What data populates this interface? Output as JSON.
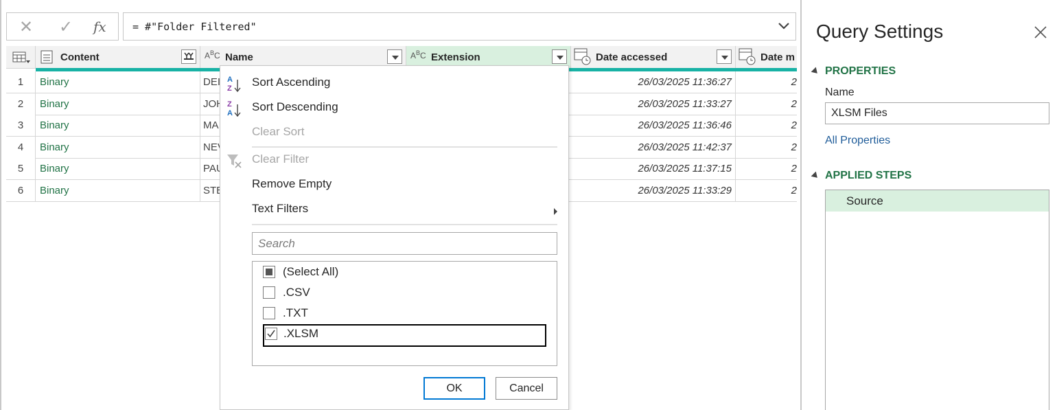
{
  "formula_bar": {
    "cancel_icon": "close-icon",
    "commit_icon": "check-icon",
    "fx_label": "fx",
    "formula": "= #\"Folder Filtered\""
  },
  "table": {
    "columns": [
      {
        "name": "Content",
        "type_icon": "table-type-icon"
      },
      {
        "name": "Name",
        "type_icon": "abc-type-icon"
      },
      {
        "name": "Extension",
        "type_icon": "abc-type-icon"
      },
      {
        "name": "Date accessed",
        "type_icon": "datetime-type-icon"
      },
      {
        "name": "Date m",
        "type_icon": "datetime-type-icon"
      }
    ],
    "rows": [
      {
        "num": "1",
        "content": "Binary",
        "name": "DEI",
        "date_accessed": "26/03/2025 11:36:27",
        "date_m": "2"
      },
      {
        "num": "2",
        "content": "Binary",
        "name": "JOH",
        "date_accessed": "26/03/2025 11:33:27",
        "date_m": "2"
      },
      {
        "num": "3",
        "content": "Binary",
        "name": "MA",
        "date_accessed": "26/03/2025 11:36:46",
        "date_m": "2"
      },
      {
        "num": "4",
        "content": "Binary",
        "name": "NEV",
        "date_accessed": "26/03/2025 11:42:37",
        "date_m": "2"
      },
      {
        "num": "5",
        "content": "Binary",
        "name": "PAU",
        "date_accessed": "26/03/2025 11:37:15",
        "date_m": "2"
      },
      {
        "num": "6",
        "content": "Binary",
        "name": "STE",
        "date_accessed": "26/03/2025 11:33:29",
        "date_m": "2"
      }
    ]
  },
  "filter_menu": {
    "sort_ascending": "Sort Ascending",
    "sort_descending": "Sort Descending",
    "clear_sort": "Clear Sort",
    "clear_filter": "Clear Filter",
    "remove_empty": "Remove Empty",
    "text_filters": "Text Filters",
    "search_placeholder": "Search",
    "options": [
      {
        "label": "(Select All)",
        "state": "partial"
      },
      {
        "label": ".CSV",
        "state": "unchecked"
      },
      {
        "label": ".TXT",
        "state": "unchecked"
      },
      {
        "label": ".XLSM",
        "state": "checked"
      }
    ],
    "ok": "OK",
    "cancel": "Cancel"
  },
  "query_settings": {
    "title": "Query Settings",
    "properties_header": "PROPERTIES",
    "name_label": "Name",
    "name_value": "XLSM Files",
    "all_properties": "All Properties",
    "applied_steps_header": "APPLIED STEPS",
    "steps": [
      "Source"
    ]
  },
  "colors": {
    "accent_green": "#217346",
    "selected_bg": "#d9f0df",
    "quality_bar": "#18b2a5",
    "link_blue": "#1f5c99"
  }
}
